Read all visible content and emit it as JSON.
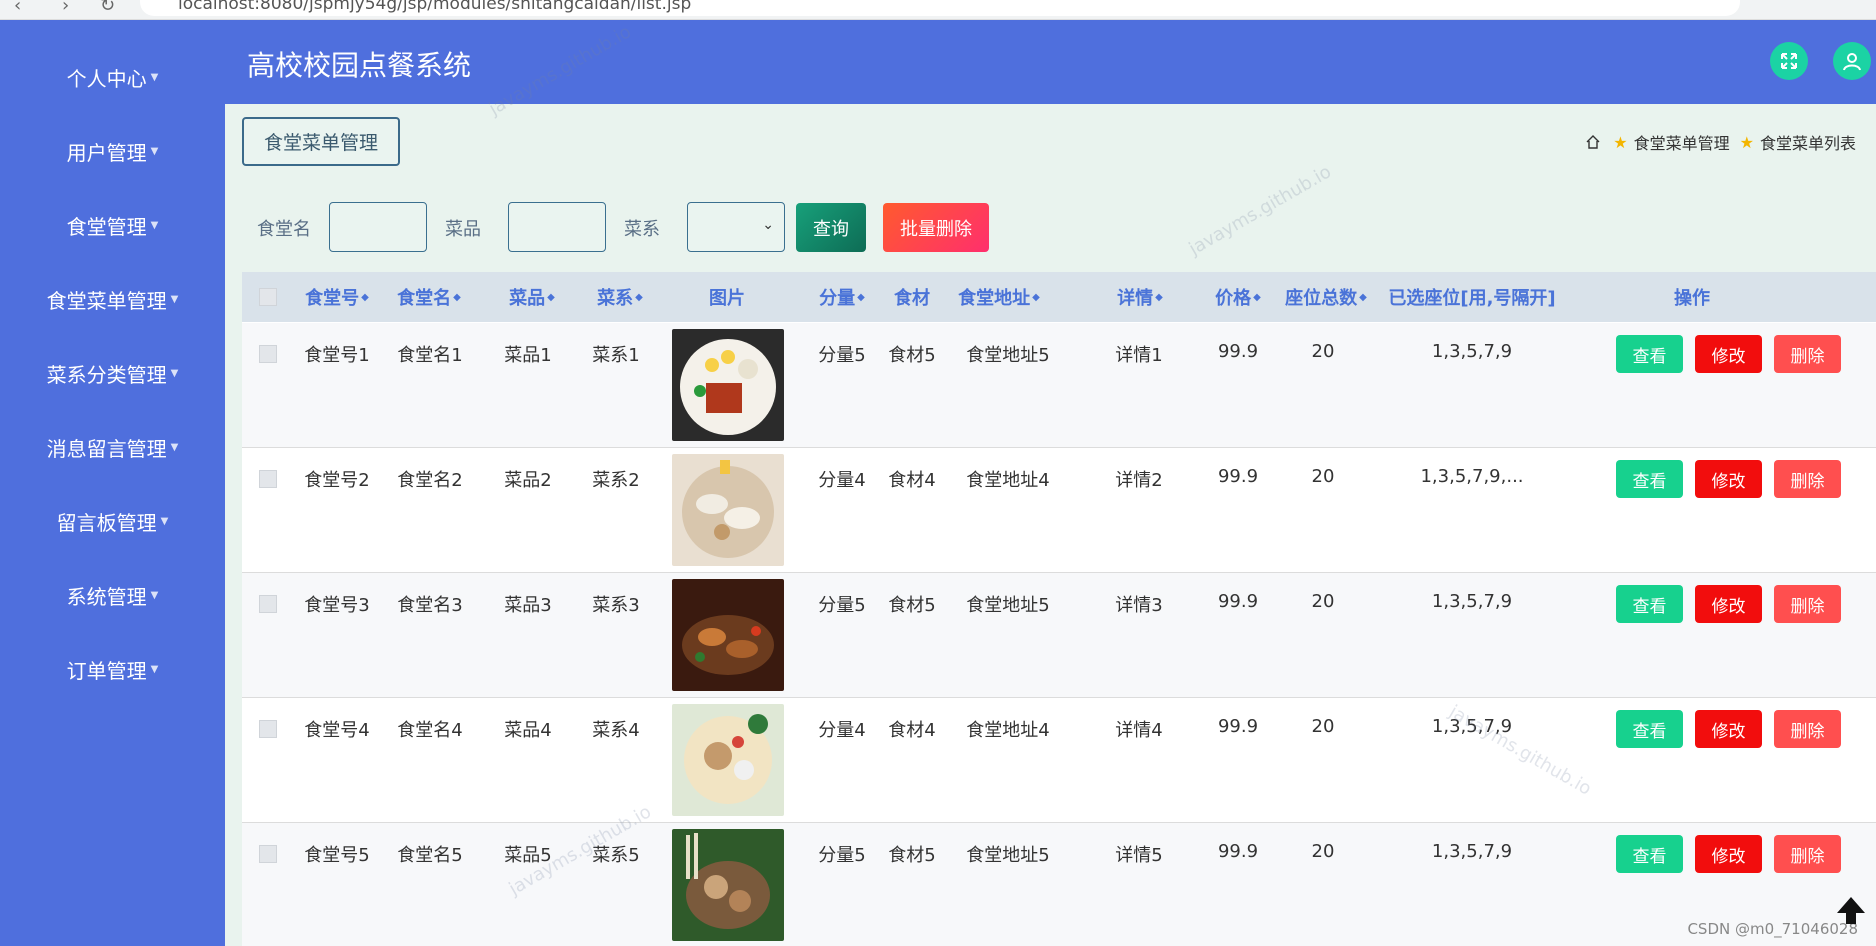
{
  "browser": {
    "url": "localhost:8080/jspmjy54g/jsp/modules/shitangcaidan/list.jsp"
  },
  "app": {
    "title": "高校校园点餐系统"
  },
  "sidebar": {
    "items": [
      {
        "label": "个人中心"
      },
      {
        "label": "用户管理"
      },
      {
        "label": "食堂管理"
      },
      {
        "label": "食堂菜单管理"
      },
      {
        "label": "菜系分类管理"
      },
      {
        "label": "消息留言管理"
      },
      {
        "label": "留言板管理"
      },
      {
        "label": "系统管理"
      },
      {
        "label": "订单管理"
      }
    ]
  },
  "page": {
    "tag": "食堂菜单管理",
    "breadcrumb": [
      "食堂菜单管理",
      "食堂菜单列表"
    ]
  },
  "search": {
    "canteen_label": "食堂名",
    "dish_label": "菜品",
    "cuisine_label": "菜系",
    "query_button": "查询",
    "batch_delete_button": "批量删除"
  },
  "table": {
    "headers": [
      "食堂号",
      "食堂名",
      "菜品",
      "菜系",
      "图片",
      "分量",
      "食材",
      "食堂地址",
      "详情",
      "价格",
      "座位总数",
      "已选座位[用,号隔开]",
      "操作"
    ],
    "rows": [
      {
        "no": "食堂号1",
        "name": "食堂名1",
        "dish": "菜品1",
        "cuisine": "菜系1",
        "portion": "分量5",
        "ingredient": "食材5",
        "address": "食堂地址5",
        "detail": "详情1",
        "price": "99.9",
        "seats": "20",
        "selected": "1,3,5,7,9"
      },
      {
        "no": "食堂号2",
        "name": "食堂名2",
        "dish": "菜品2",
        "cuisine": "菜系2",
        "portion": "分量4",
        "ingredient": "食材4",
        "address": "食堂地址4",
        "detail": "详情2",
        "price": "99.9",
        "seats": "20",
        "selected": "1,3,5,7,9,..."
      },
      {
        "no": "食堂号3",
        "name": "食堂名3",
        "dish": "菜品3",
        "cuisine": "菜系3",
        "portion": "分量5",
        "ingredient": "食材5",
        "address": "食堂地址5",
        "detail": "详情3",
        "price": "99.9",
        "seats": "20",
        "selected": "1,3,5,7,9"
      },
      {
        "no": "食堂号4",
        "name": "食堂名4",
        "dish": "菜品4",
        "cuisine": "菜系4",
        "portion": "分量4",
        "ingredient": "食材4",
        "address": "食堂地址4",
        "detail": "详情4",
        "price": "99.9",
        "seats": "20",
        "selected": "1,3,5,7,9"
      },
      {
        "no": "食堂号5",
        "name": "食堂名5",
        "dish": "菜品5",
        "cuisine": "菜系5",
        "portion": "分量5",
        "ingredient": "食材5",
        "address": "食堂地址5",
        "detail": "详情5",
        "price": "99.9",
        "seats": "20",
        "selected": "1,3,5,7,9"
      }
    ],
    "actions": {
      "view": "查看",
      "edit": "修改",
      "delete": "删除"
    }
  },
  "watermark": {
    "text": "javayms.github.io"
  },
  "footer": {
    "credit": "CSDN @m0_71046028"
  },
  "colors": {
    "primary": "#4f6fdd",
    "accent": "#1bd3a4",
    "danger": "#f20d0d"
  }
}
